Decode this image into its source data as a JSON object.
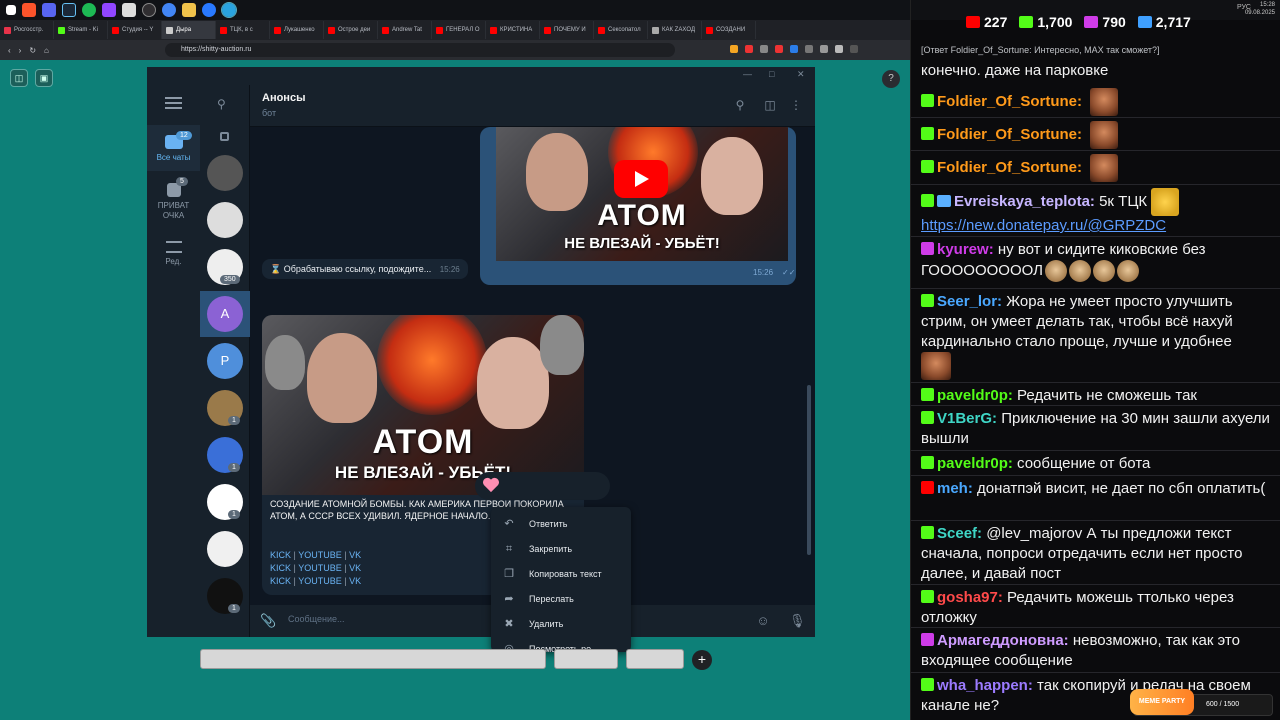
{
  "taskbar": {
    "icons": [
      "windows-icon",
      "brave-icon",
      "discord-icon",
      "steam-icon",
      "spotify-icon",
      "twitch-icon",
      "mail-icon",
      "obs-icon",
      "chrome-icon",
      "files-icon",
      "app-icon",
      "telegram-icon"
    ]
  },
  "browser": {
    "tabs": [
      {
        "label": "Росгосстр.",
        "color": "#e8334a"
      },
      {
        "label": "Stream - Ki",
        "color": "#53fc18"
      },
      {
        "label": "Студия -- Y",
        "color": "#ff0000"
      },
      {
        "label": "Дыра",
        "color": "#cccccc"
      },
      {
        "label": "ТЦК, в с",
        "color": "#ff0000"
      },
      {
        "label": "Лукашенко",
        "color": "#ff0000"
      },
      {
        "label": "Острое деи",
        "color": "#ff0000"
      },
      {
        "label": "Andrew Tat",
        "color": "#ff0000"
      },
      {
        "label": "ГЕНЕРАЛ О",
        "color": "#ff0000"
      },
      {
        "label": "КРИСТИНА",
        "color": "#ff0000"
      },
      {
        "label": "ПОЧЕМУ И",
        "color": "#ff0000"
      },
      {
        "label": "Сексопатол",
        "color": "#ff0000"
      },
      {
        "label": "КАК ZAXOД",
        "color": "#aaaaaa"
      },
      {
        "label": "СОЗДАНИ",
        "color": "#ff0000"
      }
    ],
    "url": "https://shitty-auction.ru"
  },
  "telegram": {
    "folders": [
      {
        "label": "Все чаты",
        "badge": "12"
      },
      {
        "label": "ПРИВАТ ОЧКА",
        "badge": "5"
      },
      {
        "label": "Ред.",
        "badge": ""
      }
    ],
    "chats": [
      {
        "type": "image",
        "color": "#555",
        "badge": ""
      },
      {
        "type": "image",
        "color": "#ddd",
        "badge": ""
      },
      {
        "type": "image",
        "color": "#eee",
        "badge": "350"
      },
      {
        "type": "letter",
        "letter": "A",
        "color": "#8b62d4",
        "badge": ""
      },
      {
        "type": "letter",
        "letter": "P",
        "color": "#4f8fdb",
        "badge": ""
      },
      {
        "type": "image",
        "color": "#9a7a4a",
        "badge": "1"
      },
      {
        "type": "image",
        "color": "#3a6fd8",
        "badge": "1"
      },
      {
        "type": "image",
        "color": "#ffffff",
        "badge": "1"
      },
      {
        "type": "image",
        "color": "#f0f0f0",
        "badge": ""
      },
      {
        "type": "image",
        "color": "#111111",
        "badge": "1"
      }
    ],
    "chat_title": "Анонсы",
    "chat_subtitle": "бот",
    "thumb_title": "ATOM",
    "thumb_subtitle": "НЕ ВЛЕЗАЙ - УБЬЁТ!",
    "outgoing_time": "15:26",
    "processing_text": "Обрабатываю ссылку, подождите...",
    "processing_time": "15:26",
    "message_text": "СОЗДАНИЕ АТОМНОЙ БОМБЫ. КАК АМЕРИКА ПЕРВОЙ ПОКОРИЛА АТОМ, А СССР ВСЕХ УДИВИЛ. ЯДЕРНОЕ НАЧАЛО.",
    "link_rows": [
      [
        "KICK",
        "YOUTUBE",
        "VK"
      ],
      [
        "KICK",
        "YOUTUBE",
        "VK"
      ],
      [
        "KICK",
        "YOUTUBE",
        "VK"
      ]
    ],
    "composer_placeholder": "Сообщение...",
    "context_menu": [
      "Ответить",
      "Закрепить",
      "Копировать текст",
      "Переслать",
      "Удалить",
      "Посмотреть ре..."
    ]
  },
  "stream": {
    "stats": [
      {
        "value": "227",
        "color": "#ff0000"
      },
      {
        "value": "1,700",
        "color": "#53fc18"
      },
      {
        "value": "790",
        "color": "#cf3ce8"
      },
      {
        "value": "2,717",
        "color": "#3fa0ff"
      }
    ],
    "clock_time": "15:28",
    "clock_date": "09.08.2025",
    "lang": "РУС",
    "reply_context": "[Ответ Foldier_Of_Sortune: Интересно, MAX так сможет?]",
    "messages": [
      {
        "user": "",
        "user_color": "#ffffff",
        "badge": "",
        "text": "конечно. даже на парковке"
      },
      {
        "user": "Foldier_Of_Sortune:",
        "user_color": "#ff9a1a",
        "badge": "#53fc18",
        "text": ""
      },
      {
        "user": "Foldier_Of_Sortune:",
        "user_color": "#ff9a1a",
        "badge": "#53fc18",
        "text": ""
      },
      {
        "user": "Foldier_Of_Sortune:",
        "user_color": "#ff9a1a",
        "badge": "#53fc18",
        "text": ""
      },
      {
        "user": "Evreiskaya_teplota:",
        "user_color": "#c7b6ff",
        "badge": "#53fc18",
        "text": "5к ТЦК",
        "link": "https://new.donatepay.ru/@GRPZDC"
      },
      {
        "user": "kyurew:",
        "user_color": "#cf3ce8",
        "badge": "#cf3ce8",
        "text": "ну вот и сидите киковские без ГОООООООООЛ"
      },
      {
        "user": "Seer_lor:",
        "user_color": "#4aa8ff",
        "badge": "#53fc18",
        "text": "Жора не умеет просто улучшить стрим, он умеет делать так, чтобы всё нахуй кардинально стало проще, лучше и удобнее"
      },
      {
        "user": "paveldr0p:",
        "user_color": "#53fc18",
        "badge": "#53fc18",
        "text": "Редачить не сможешь так"
      },
      {
        "user": "V1BerG:",
        "user_color": "#3fd6c6",
        "badge": "#53fc18",
        "text": "Приключение на 30 мин зашли ахуели вышли"
      },
      {
        "user": "paveldr0p:",
        "user_color": "#53fc18",
        "badge": "#53fc18",
        "text": "сообщение от бота"
      },
      {
        "user": "meh:",
        "user_color": "#4aa8ff",
        "badge": "#ff0000",
        "text": "донатпэй висит, не дает по сбп оплатить("
      },
      {
        "user": "Sceef:",
        "user_color": "#3fd6c6",
        "badge": "#53fc18",
        "text": "@lev_majorov А ты предложи текст сначала, попроси отредачить если нет просто далее, и давай пост"
      },
      {
        "user": "gosha97:",
        "user_color": "#ff4a4a",
        "badge": "#53fc18",
        "text": "Редачить можешь ттолько через отложку"
      },
      {
        "user": "Армагеддоновна:",
        "user_color": "#cf9cff",
        "badge": "#cf3ce8",
        "text": "невозможно, так как это входящее сообщение"
      },
      {
        "user": "wha_happen:",
        "user_color": "#9c7bff",
        "badge": "#53fc18",
        "text": "так скопируй и редач на своем канале не?"
      }
    ],
    "meme_label": "MEME PARTY",
    "meme_value": "600 / 1500"
  }
}
